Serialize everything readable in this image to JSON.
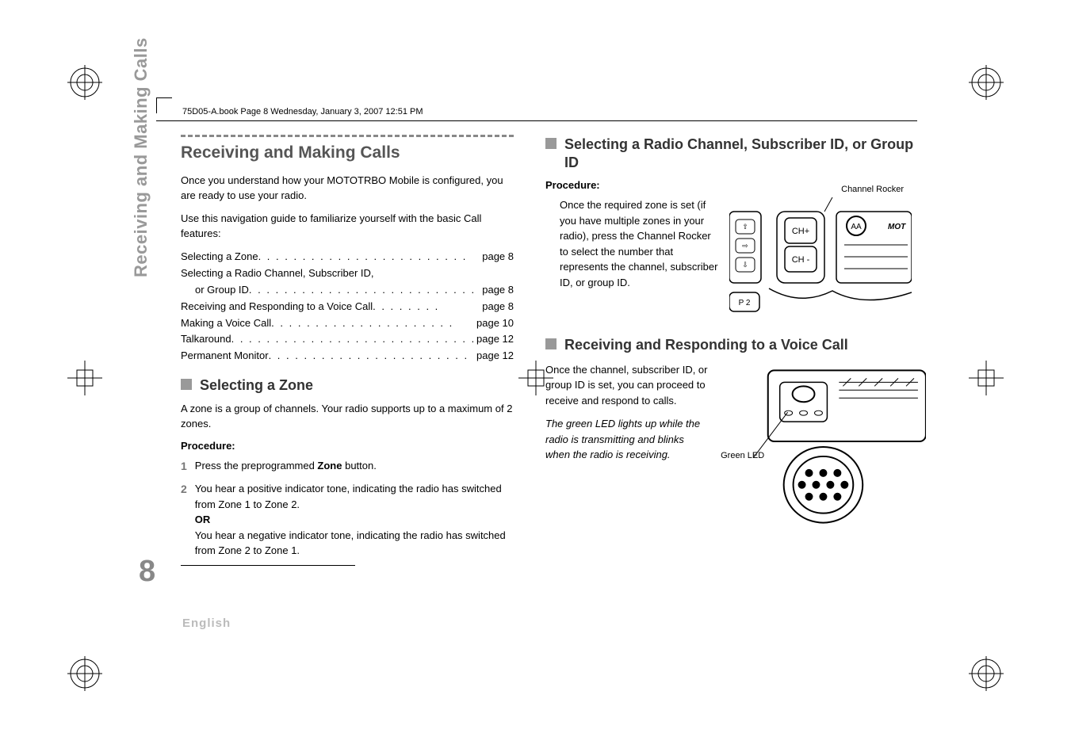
{
  "header": "75D05-A.book  Page 8  Wednesday, January 3, 2007  12:51 PM",
  "sidebar_label": "Receiving and Making Calls",
  "page_number": "8",
  "language": "English",
  "main_title": "Receiving and Making Calls",
  "intro_1": "Once you understand how your MOTOTRBO Mobile is configured, you are ready to use your radio.",
  "intro_2": "Use this navigation guide to familiarize yourself with the basic Call features:",
  "toc": [
    {
      "label": "Selecting a Zone",
      "page": "page 8"
    },
    {
      "label": "Selecting a Radio Channel, Subscriber ID,",
      "page": "",
      "wrap": true
    },
    {
      "label": "or Group ID",
      "page": "page 8",
      "indent": true
    },
    {
      "label": "Receiving and Responding to a Voice Call",
      "page": "page 8"
    },
    {
      "label": "Making a Voice Call",
      "page": "page 10"
    },
    {
      "label": "Talkaround",
      "page": "page 12"
    },
    {
      "label": "Permanent Monitor",
      "page": "page 12"
    }
  ],
  "section1_title": "Selecting a Zone",
  "section1_body": "A zone is a group of channels. Your radio supports up to a maximum of 2 zones.",
  "procedure_label": "Procedure:",
  "step1_num": "1",
  "step1_pre": "Press the preprogrammed ",
  "step1_bold": "Zone",
  "step1_post": " button.",
  "step2_num": "2",
  "step2_line1": "You hear a positive indicator tone, indicating the radio has switched from Zone 1 to Zone 2.",
  "step2_or": "OR",
  "step2_line2": "You hear a negative indicator tone, indicating the radio has switched from Zone 2 to Zone 1.",
  "section2_title": "Selecting a Radio Channel, Subscriber ID, or Group ID",
  "channel_rocker_label": "Channel Rocker",
  "section2_step": "Once the required zone is set (if you have multiple zones in your radio), press the Channel Rocker to select the number that represents the channel, subscriber ID, or group ID.",
  "section3_title": "Receiving and Responding to a Voice Call",
  "section3_body1": "Once the channel, subscriber ID, or group ID is set, you can proceed to receive and respond to calls.",
  "section3_body2": "The green LED lights up while the radio is transmitting and blinks when the radio is receiving.",
  "green_led_label": "Green LED",
  "illustration_ch_plus": "CH+",
  "illustration_ch_minus": "CH -",
  "illustration_aa": "AA",
  "illustration_p2": "P 2",
  "illustration_mot": "MOT"
}
